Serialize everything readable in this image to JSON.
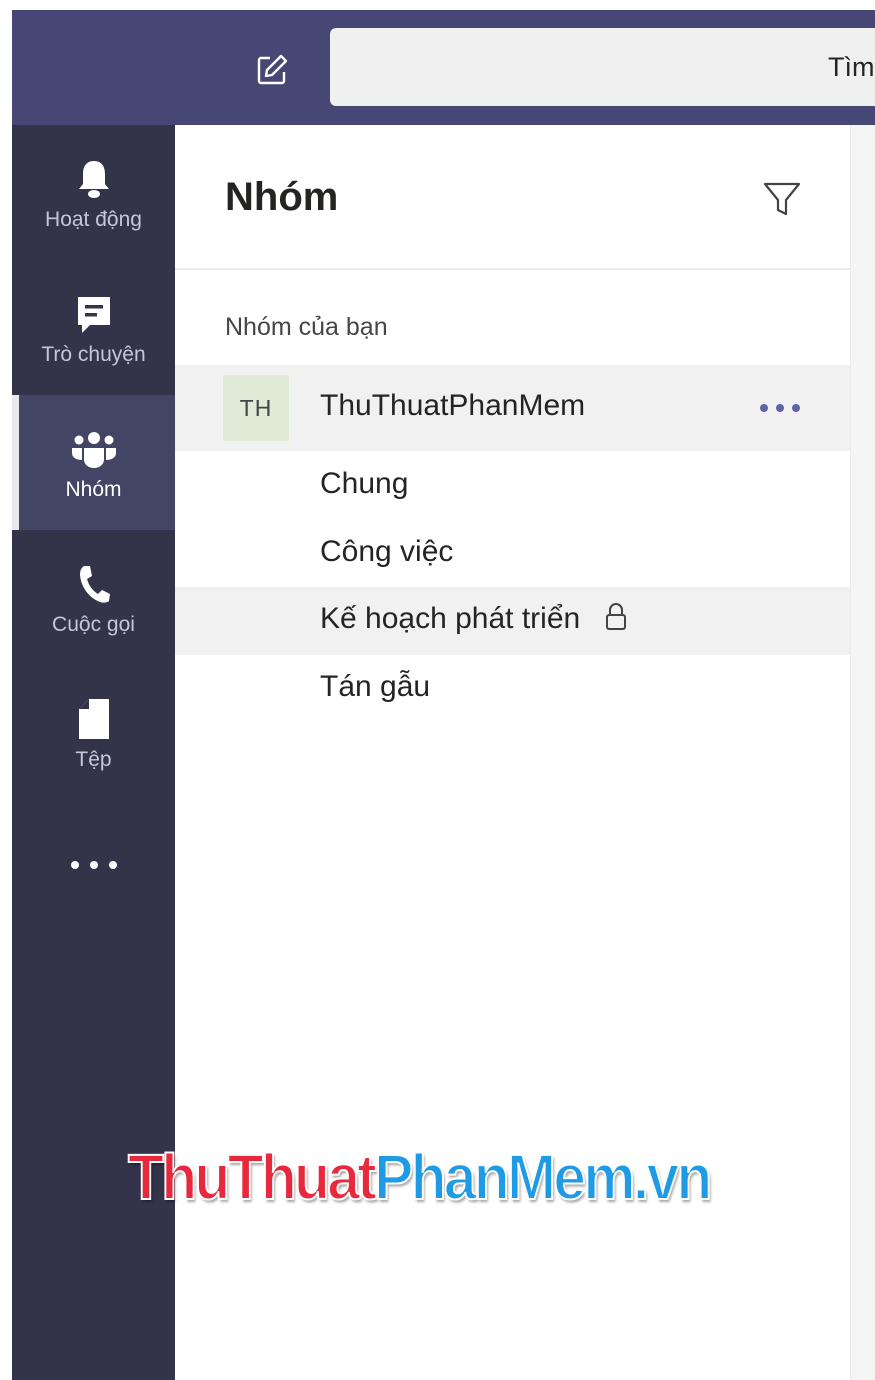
{
  "topbar": {
    "search_placeholder": "Tìm"
  },
  "rail": {
    "items": [
      {
        "label": "Hoạt động",
        "icon": "bell-icon"
      },
      {
        "label": "Trò chuyện",
        "icon": "chat-icon"
      },
      {
        "label": "Nhóm",
        "icon": "teams-icon",
        "active": true
      },
      {
        "label": "Cuộc gọi",
        "icon": "phone-icon"
      },
      {
        "label": "Tệp",
        "icon": "file-icon"
      }
    ],
    "more_icon": "more-horizontal-icon"
  },
  "panel": {
    "title": "Nhóm",
    "section_label": "Nhóm của bạn",
    "team": {
      "initials": "TH",
      "name": "ThuThuatPhanMem"
    },
    "channels": [
      {
        "name": "Chung"
      },
      {
        "name": "Công việc"
      },
      {
        "name": "Kế hoạch phát triển",
        "private": true
      },
      {
        "name": "Tán gẫu"
      }
    ]
  },
  "watermark": {
    "part1": "ThuThuat",
    "part2": "PhanMem.vn"
  },
  "colors": {
    "topbar": "#464775",
    "rail": "#33344a",
    "accent": "#6264a7",
    "red_watermark": "#e8283c",
    "blue_watermark": "#1f9be6"
  }
}
